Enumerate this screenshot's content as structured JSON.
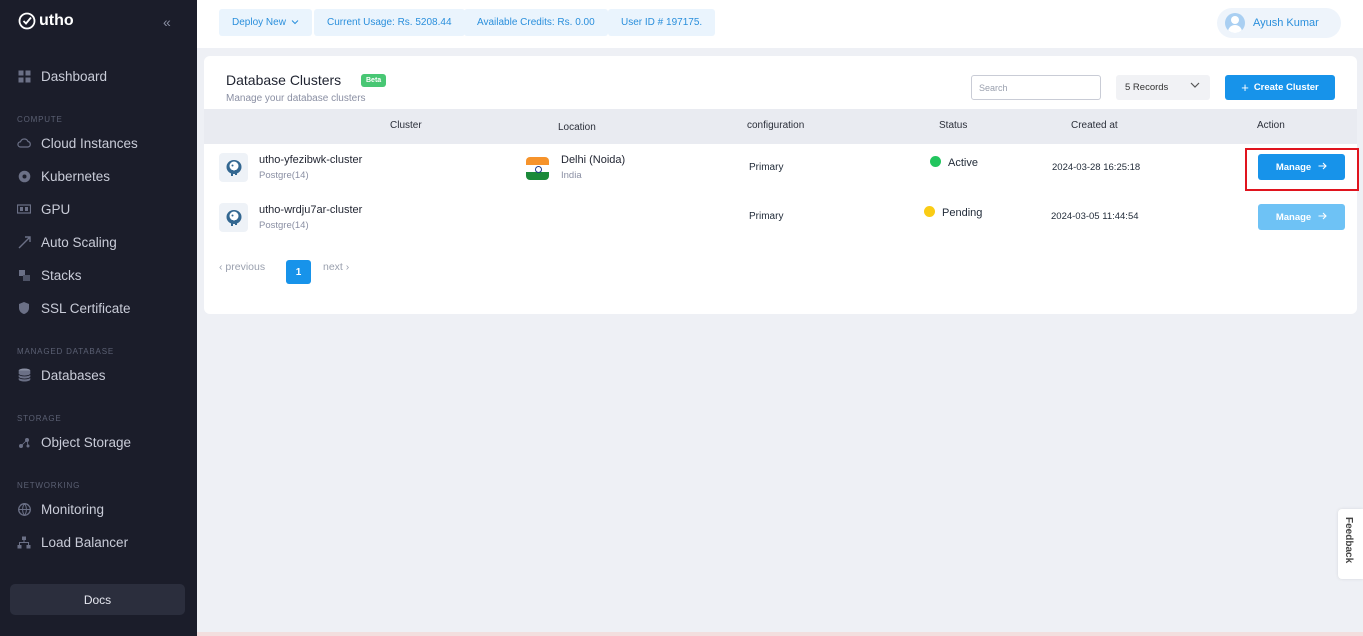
{
  "brand": {
    "name": "utho"
  },
  "sidebar": {
    "items": [
      {
        "label": "Dashboard",
        "icon": "dashboard-icon"
      },
      {
        "label": "Cloud Instances",
        "icon": "cloud-icon"
      },
      {
        "label": "Kubernetes",
        "icon": "kubernetes-icon"
      },
      {
        "label": "GPU",
        "icon": "gpu-icon"
      },
      {
        "label": "Auto Scaling",
        "icon": "auto-scaling-icon"
      },
      {
        "label": "Stacks",
        "icon": "stacks-icon"
      },
      {
        "label": "SSL Certificate",
        "icon": "ssl-icon"
      },
      {
        "label": "Databases",
        "icon": "database-icon"
      },
      {
        "label": "Object Storage",
        "icon": "object-storage-icon"
      },
      {
        "label": "Monitoring",
        "icon": "monitoring-icon"
      },
      {
        "label": "Load Balancer",
        "icon": "load-balancer-icon"
      }
    ],
    "sections": {
      "compute": "COMPUTE",
      "managed_database": "MANAGED DATABASE",
      "storage": "STORAGE",
      "networking": "NETWORKING"
    },
    "docs": "Docs"
  },
  "topbar": {
    "deploy": "Deploy New",
    "usage": "Current Usage: Rs. 5208.44",
    "credits": "Available Credits: Rs. 0.00",
    "user_id": "User ID # 197175.",
    "user_name": "Ayush Kumar"
  },
  "page": {
    "title": "Database Clusters",
    "badge": "Beta",
    "subtitle": "Manage your database clusters",
    "search_placeholder": "Search",
    "records": "5 Records",
    "create": "Create Cluster"
  },
  "table": {
    "headers": {
      "cluster": "Cluster",
      "location": "Location",
      "configuration": "configuration",
      "status": "Status",
      "created": "Created at",
      "action": "Action"
    },
    "rows": [
      {
        "name": "utho-yfezibwk-cluster",
        "engine": "Postgre(14)",
        "city": "Delhi (Noida)",
        "country": "India",
        "configuration": "Primary",
        "status": "Active",
        "created": "2024-03-28 16:25:18",
        "action": "Manage"
      },
      {
        "name": "utho-wrdju7ar-cluster",
        "engine": "Postgre(14)",
        "city": "",
        "country": "",
        "configuration": "Primary",
        "status": "Pending",
        "created": "2024-03-05 11:44:54",
        "action": "Manage"
      }
    ]
  },
  "pagination": {
    "previous": "‹ previous",
    "page": "1",
    "next": "next ›"
  },
  "feedback": "Feedback",
  "colors": {
    "sidebar_bg": "#1b1d2a",
    "primary": "#1793ea",
    "active": "#22c55e",
    "pending": "#facc15",
    "beta": "#48c774"
  }
}
